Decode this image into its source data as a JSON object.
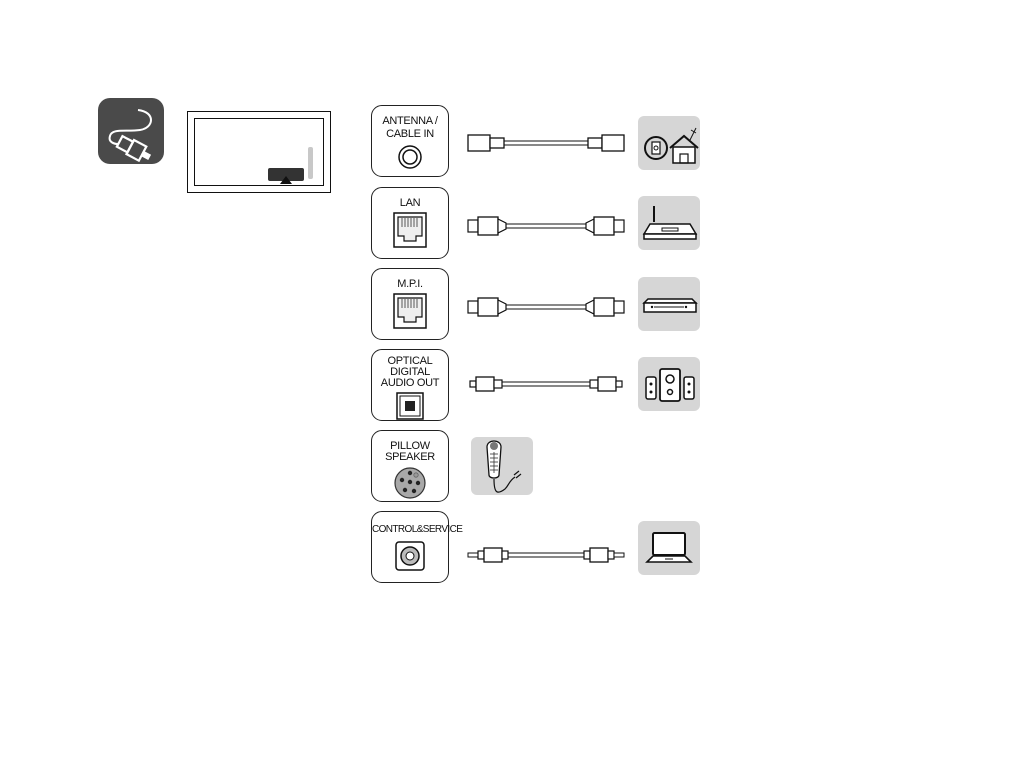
{
  "page": {
    "section_icon": "cable-connection-icon",
    "tv_diagram": {
      "description": "rear panel location indicator",
      "icons": [
        "tv-panel-icon",
        "port-location-marker-icon"
      ]
    }
  },
  "connections": [
    {
      "id": "antenna",
      "port_label": "ANTENNA / CABLE IN",
      "port_icon": "coax-port-icon",
      "cable_icon": "coax-cable-icon",
      "device_icon": "antenna-house-icon"
    },
    {
      "id": "lan",
      "port_label": "LAN",
      "port_icon": "rj45-port-icon",
      "cable_icon": "lan-cable-icon",
      "device_icon": "router-icon"
    },
    {
      "id": "mpi",
      "port_label": "M.P.I.",
      "port_icon": "rj45-port-icon",
      "cable_icon": "lan-cable-icon",
      "device_icon": "set-top-box-icon"
    },
    {
      "id": "optical",
      "port_label": "OPTICAL DIGITAL AUDIO OUT",
      "port_icon": "optical-port-icon",
      "cable_icon": "optical-cable-icon",
      "device_icon": "speaker-system-icon"
    },
    {
      "id": "pillow",
      "port_label": "PILLOW SPEAKER",
      "port_icon": "din-port-icon",
      "cable_icon": "",
      "device_icon": "pillow-speaker-remote-icon"
    },
    {
      "id": "control",
      "port_label": "CONTROL&SERVICE",
      "port_icon": "audio-jack-port-icon",
      "cable_icon": "audio-jack-cable-icon",
      "device_icon": "laptop-icon"
    }
  ],
  "labels": {
    "antenna_line1": "ANTENNA /",
    "antenna_line2": "CABLE IN",
    "lan": "LAN",
    "mpi": "M.P.I.",
    "optical_line1": "OPTICAL",
    "optical_line2": "DIGITAL",
    "optical_line3": "AUDIO OUT",
    "pillow_line1": "PILLOW",
    "pillow_line2": "SPEAKER",
    "control": "CONTROL&SERVICE"
  },
  "colors": {
    "icon_bg": "#4a4a4a",
    "device_bg": "#d6d6d6",
    "line": "#111111"
  }
}
